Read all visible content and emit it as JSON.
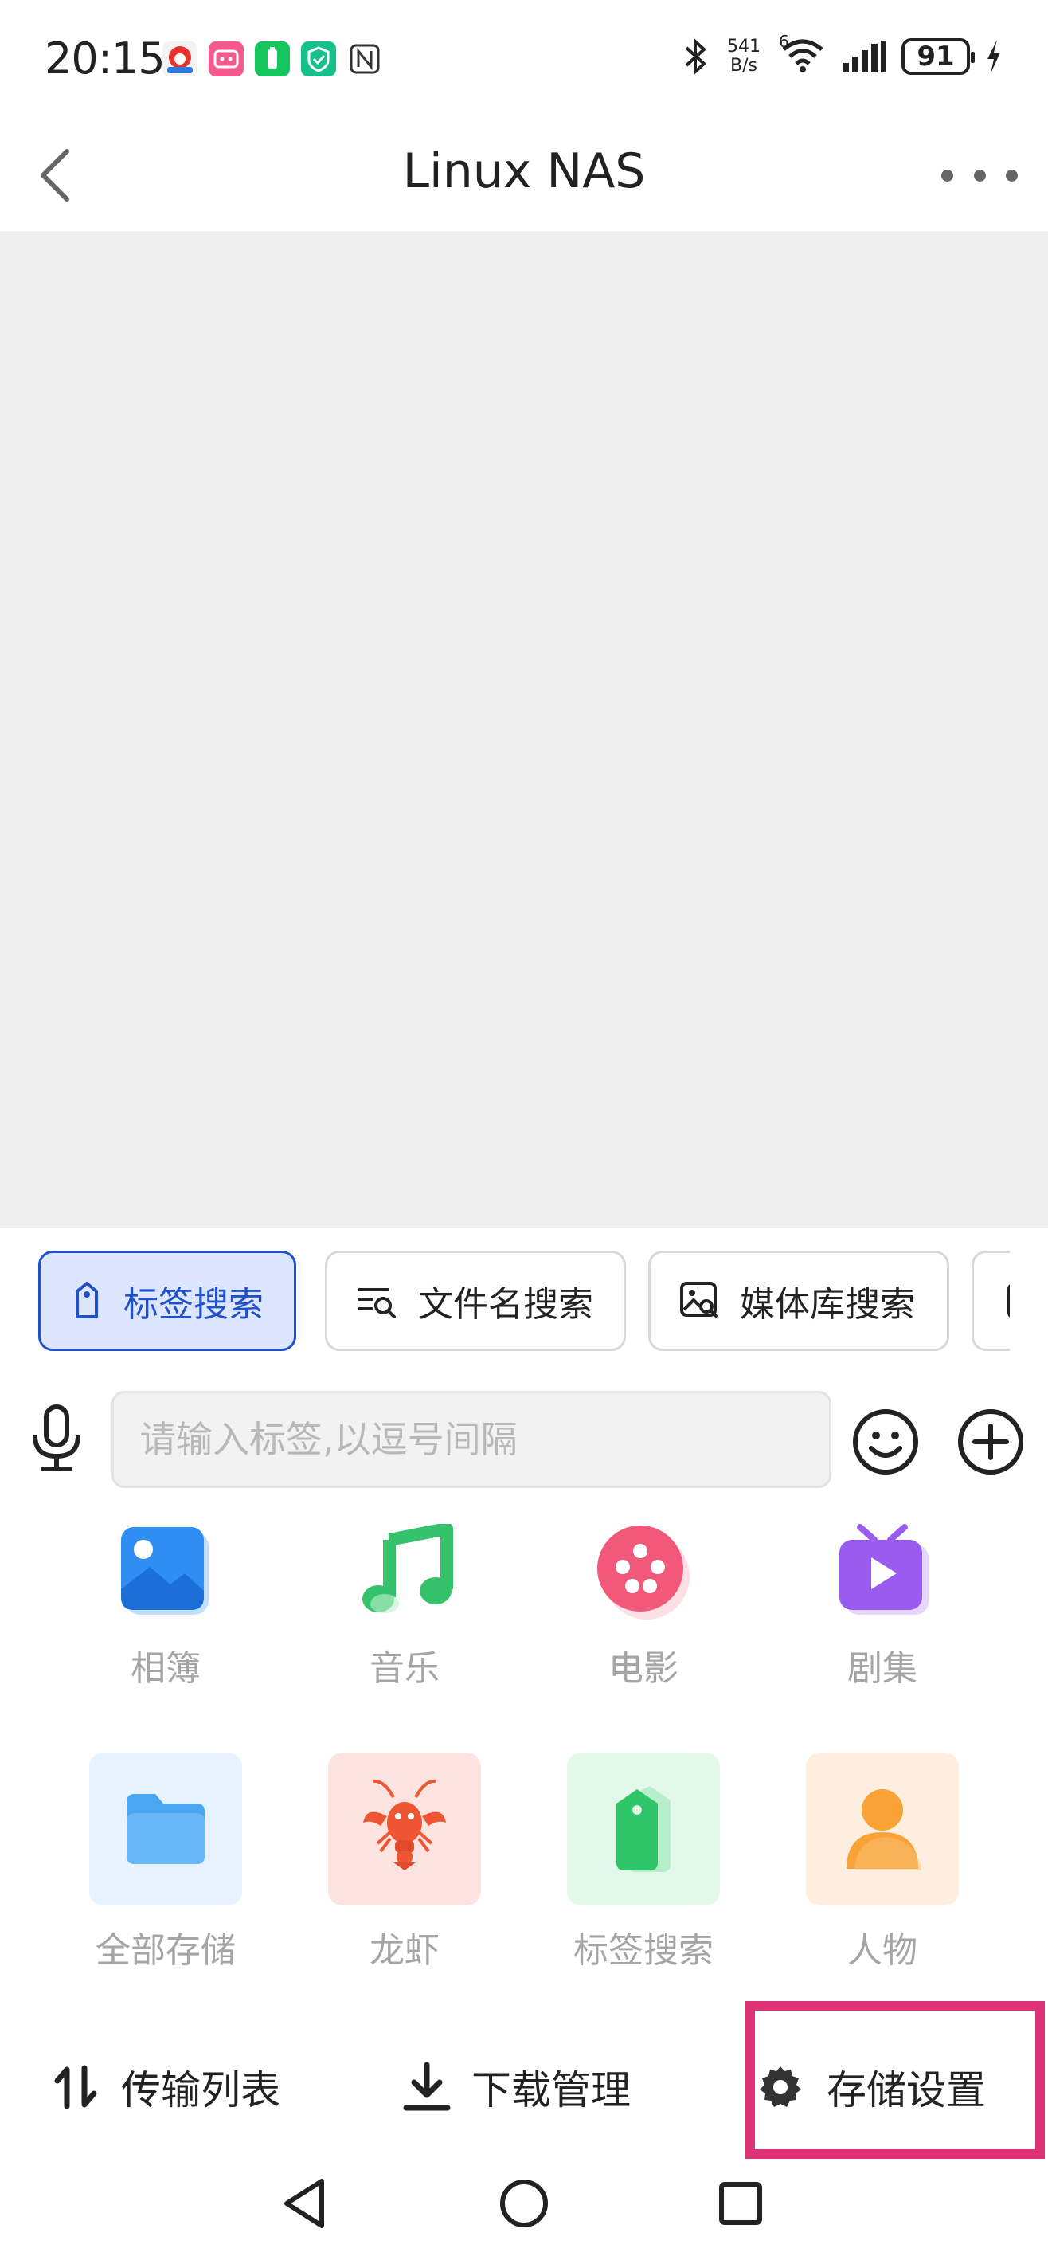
{
  "status_bar": {
    "time": "20:15",
    "net_speed_value": "541",
    "net_speed_unit": "B/s",
    "wifi_badge": "6",
    "battery_level": "91",
    "notification_icons": [
      "app-red-icon",
      "bilibili-icon",
      "green-battery-icon",
      "green-shield-icon",
      "nfc-icon"
    ]
  },
  "header": {
    "title": "Linux NAS"
  },
  "search_tabs": [
    {
      "label": "标签搜索",
      "icon": "tag-icon",
      "active": true
    },
    {
      "label": "文件名搜索",
      "icon": "filename-search-icon",
      "active": false
    },
    {
      "label": "媒体库搜索",
      "icon": "image-search-icon",
      "active": false
    }
  ],
  "input": {
    "placeholder": "请输入标签,以逗号间隔",
    "value": ""
  },
  "categories_row1": [
    {
      "label": "相簿",
      "icon": "album-icon",
      "color": "#2f8ef3"
    },
    {
      "label": "音乐",
      "icon": "music-note-icon",
      "color": "#34c26a"
    },
    {
      "label": "电影",
      "icon": "film-reel-icon",
      "color": "#f2587a"
    },
    {
      "label": "剧集",
      "icon": "tv-icon",
      "color": "#9a5cf0"
    }
  ],
  "categories_row2": [
    {
      "label": "全部存储",
      "icon": "folder-icon",
      "tile_color": "#e6f2fe",
      "color": "#4aa5f2"
    },
    {
      "label": "龙虾",
      "icon": "lobster-icon",
      "tile_color": "#fde4e1",
      "color": "#ee5533"
    },
    {
      "label": "标签搜索",
      "icon": "tag-icon",
      "tile_color": "#e2f9ea",
      "color": "#2fc66a"
    },
    {
      "label": "人物",
      "icon": "person-icon",
      "tile_color": "#feeedf",
      "color": "#f9a236"
    }
  ],
  "actions": {
    "transfer_list": "传输列表",
    "download_manager": "下载管理",
    "storage_settings": "存储设置"
  },
  "colors": {
    "accent": "#2150c8",
    "highlight": "#dd3377"
  }
}
